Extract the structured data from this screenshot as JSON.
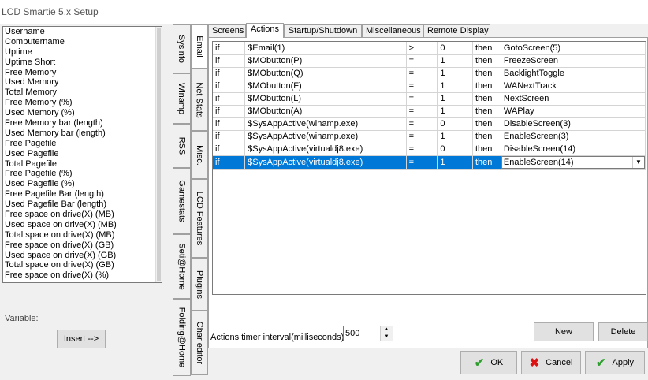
{
  "window": {
    "title": "LCD Smartie 5.x Setup"
  },
  "variables": {
    "items": [
      "Username",
      "Computername",
      "Uptime",
      "Uptime Short",
      "Free Memory",
      "Used Memory",
      "Total Memory",
      "Free Memory (%)",
      "Used Memory (%)",
      "Free Memory bar (length)",
      "Used Memory bar (length)",
      "Free Pagefile",
      "Used Pagefile",
      "Total Pagefile",
      "Free Pagefile (%)",
      "Used Pagefile (%)",
      "Free Pagefile Bar (length)",
      "Used Pagefile Bar (length)",
      "Free space on drive(X) (MB)",
      "Used space on drive(X) (MB)",
      "Total space on drive(X) (MB)",
      "Free space on drive(X) (GB)",
      "Used space on drive(X) (GB)",
      "Total space on drive(X) (GB)",
      "Free space on drive(X) (%)"
    ],
    "label": "Variable:",
    "insert_label": "Insert -->"
  },
  "left_tabs_col1": [
    "Sysinfo",
    "Winamp",
    "RSS",
    "Gamestats",
    "Seti@Home",
    "Folding@Home"
  ],
  "left_tabs_col2": [
    "Email",
    "Net Stats",
    "Misc.",
    "LCD Features",
    "Plugins",
    "Char editor"
  ],
  "top_tabs": [
    "Screens",
    "Actions",
    "Startup/Shutdown",
    "Miscellaneous",
    "Remote Display"
  ],
  "actions": {
    "rows": [
      {
        "cond": "if",
        "var": "$Email(1)",
        "op": ">",
        "val": "0",
        "then": "then",
        "action": "GotoScreen(5)"
      },
      {
        "cond": "if",
        "var": "$MObutton(P)",
        "op": "=",
        "val": "1",
        "then": "then",
        "action": "FreezeScreen"
      },
      {
        "cond": "if",
        "var": "$MObutton(Q)",
        "op": "=",
        "val": "1",
        "then": "then",
        "action": "BacklightToggle"
      },
      {
        "cond": "if",
        "var": "$MObutton(F)",
        "op": "=",
        "val": "1",
        "then": "then",
        "action": "WANextTrack"
      },
      {
        "cond": "if",
        "var": "$MObutton(L)",
        "op": "=",
        "val": "1",
        "then": "then",
        "action": "NextScreen"
      },
      {
        "cond": "if",
        "var": "$MObutton(A)",
        "op": "=",
        "val": "1",
        "then": "then",
        "action": "WAPlay"
      },
      {
        "cond": "if",
        "var": "$SysAppActive(winamp.exe)",
        "op": "=",
        "val": "0",
        "then": "then",
        "action": "DisableScreen(3)"
      },
      {
        "cond": "if",
        "var": "$SysAppActive(winamp.exe)",
        "op": "=",
        "val": "1",
        "then": "then",
        "action": "EnableScreen(3)"
      },
      {
        "cond": "if",
        "var": "$SysAppActive(virtualdj8.exe)",
        "op": "=",
        "val": "0",
        "then": "then",
        "action": "DisableScreen(14)"
      },
      {
        "cond": "if",
        "var": "$SysAppActive(virtualdj8.exe)",
        "op": "=",
        "val": "1",
        "then": "then",
        "action": "EnableScreen(14)"
      }
    ],
    "timer_label": "Actions timer interval(milliseconds):",
    "timer_value": "500",
    "new_label": "New",
    "delete_label": "Delete"
  },
  "footer": {
    "ok_label": "OK",
    "cancel_label": "Cancel",
    "apply_label": "Apply"
  }
}
